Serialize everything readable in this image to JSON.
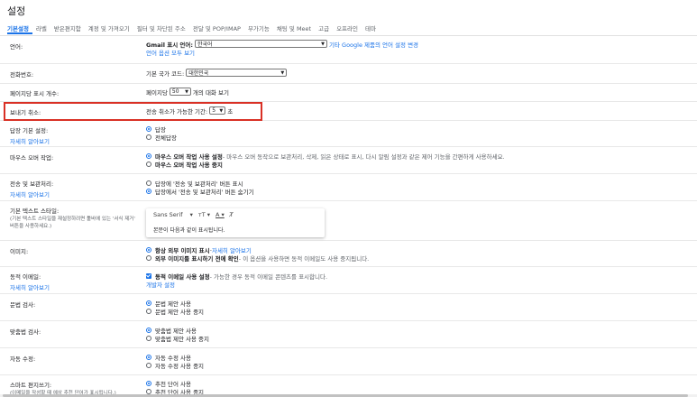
{
  "page_title": "설정",
  "tabs": [
    "기본설정",
    "라벨",
    "받은편지함",
    "계정 및 가져오기",
    "필터 및 차단된 주소",
    "전달 및 POP/IMAP",
    "부가기능",
    "채팅 및 Meet",
    "고급",
    "오프라인",
    "테마"
  ],
  "language": {
    "label": "언어:",
    "gmail_language_label": "Gmail 표시 언어:",
    "selected": "한국어",
    "other_settings_link": "기타 Google 제품의 언어 설정 변경",
    "show_all_link": "언어 옵션 모두 보기"
  },
  "phone": {
    "label": "전화번호:",
    "country_code_label": "기본 국가 코드:",
    "selected": "대한민국"
  },
  "page_size": {
    "label": "페이지당 표시 개수:",
    "prefix": "페이지당",
    "selected": "50",
    "suffix": "개의 대화 보기"
  },
  "undo_send": {
    "label": "보내기 취소:",
    "period_label": "전송 취소가 가능한 기간:",
    "selected": "5",
    "suffix": "초"
  },
  "reply_default": {
    "label": "답장 기본 설정:",
    "learn_more": "자세히 알아보기",
    "options": [
      "답장",
      "전체답장"
    ],
    "selected_index": 0
  },
  "hover_actions": {
    "label": "마우스 오버 작업:",
    "options": [
      {
        "title": "마우스 오버 작업 사용 설정",
        "desc": " - 마우스 오버 동작으로 보관처리, 삭제, 읽은 상태로 표시, 다시 알림 설정과 같은 제어 기능을 간편하게 사용하세요."
      },
      {
        "title": "마우스 오버 작업 사용 중지",
        "desc": ""
      }
    ],
    "selected_index": 0
  },
  "send_archive": {
    "label": "전송 및 보관처리:",
    "learn_more": "자세히 알아보기",
    "options": [
      "답장에 '전송 및 보관처리' 버튼 표시",
      "답장에서 '전송 및 보관처리' 버튼 숨기기"
    ],
    "selected_index": 1
  },
  "default_text_style": {
    "label": "기본 텍스트 스타일:",
    "note": "(기본 텍스트 스타일을 재설정하려면 툴바에 있는 '서식 제거' 버튼을 사용하세요.)",
    "font": "Sans Serif",
    "preview": "본문이 다음과 같이 표시됩니다."
  },
  "images": {
    "label": "이미지:",
    "options": [
      {
        "title": "항상 외부 이미지 표시",
        "sep": " - ",
        "link": "자세히 알아보기",
        "desc": ""
      },
      {
        "title": "외부 이미지를 표시하기 전에 확인",
        "sep": "",
        "link": "",
        "desc": " - 이 옵션을 사용하면 동적 이메일도 사용 중지됩니다."
      }
    ],
    "selected_index": 0
  },
  "dynamic_email": {
    "label": "동적 이메일:",
    "learn_more": "자세히 알아보기",
    "check_title": "동적 이메일 사용 설정",
    "check_desc": " - 가능한 경우 동적 이메일 콘텐츠를 표시합니다.",
    "dev_link": "개발자 설정",
    "checked": true
  },
  "grammar": {
    "label": "문법 검사:",
    "options": [
      "문법 제안 사용",
      "문법 제안 사용 중지"
    ],
    "selected_index": 0
  },
  "spelling": {
    "label": "맞춤법 검사:",
    "options": [
      "맞춤법 제안 사용",
      "맞춤법 제안 사용 중지"
    ],
    "selected_index": 0
  },
  "autocorrect": {
    "label": "자동 수정:",
    "options": [
      "자동 수정 사용",
      "자동 수정 사용 중지"
    ],
    "selected_index": 0
  },
  "smart_compose": {
    "label": "스마트 편지쓰기:",
    "note": "(이메일을 작성할 때 예상 추천 단어가 표시됩니다.)",
    "options": [
      "추천 단어 사용",
      "추천 단어 사용 중지"
    ],
    "selected_index": 0
  },
  "colors": {
    "accent": "#1a73e8",
    "highlight": "#d93025"
  }
}
